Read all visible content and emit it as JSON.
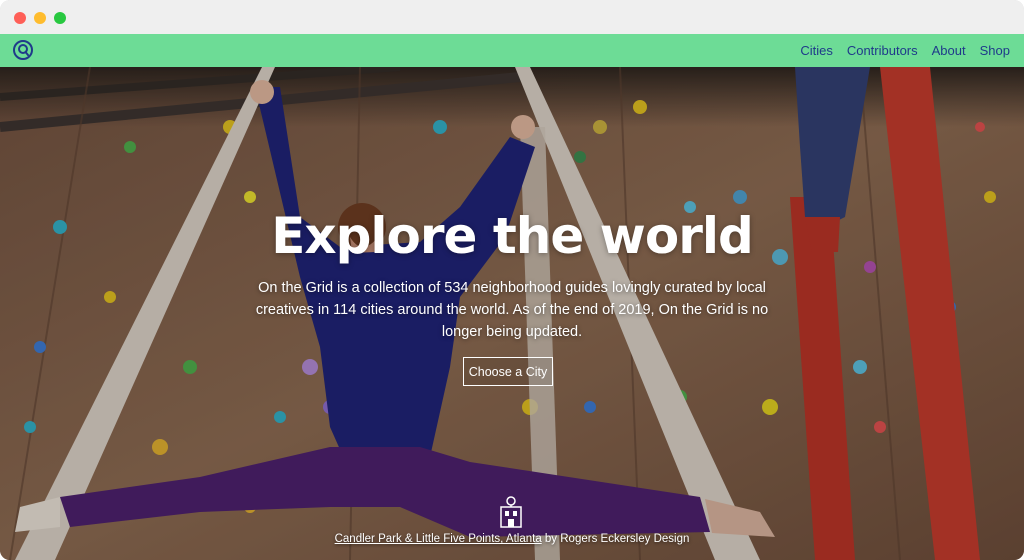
{
  "window": {
    "traffic_lights": [
      "close",
      "minimize",
      "maximize"
    ]
  },
  "nav": {
    "logo_icon": "search-logo-icon",
    "links": [
      "Cities",
      "Contributors",
      "About",
      "Shop"
    ]
  },
  "hero": {
    "headline": "Explore the world",
    "description": "On the Grid is a collection of 534 neighborhood guides lovingly curated by local creatives in 114 cities around the world. As of the end of 2019, On the Grid is no longer being updated.",
    "cta_label": "Choose a City",
    "credit_link": "Candler Park & Little Five Points, Atlanta",
    "credit_suffix": " by Rogers Eckersley Design",
    "credit_icon": "building-illustration-icon"
  },
  "colors": {
    "nav_background": "#6ddc96",
    "nav_link": "#1f3a8a",
    "hero_text": "#ffffff"
  }
}
